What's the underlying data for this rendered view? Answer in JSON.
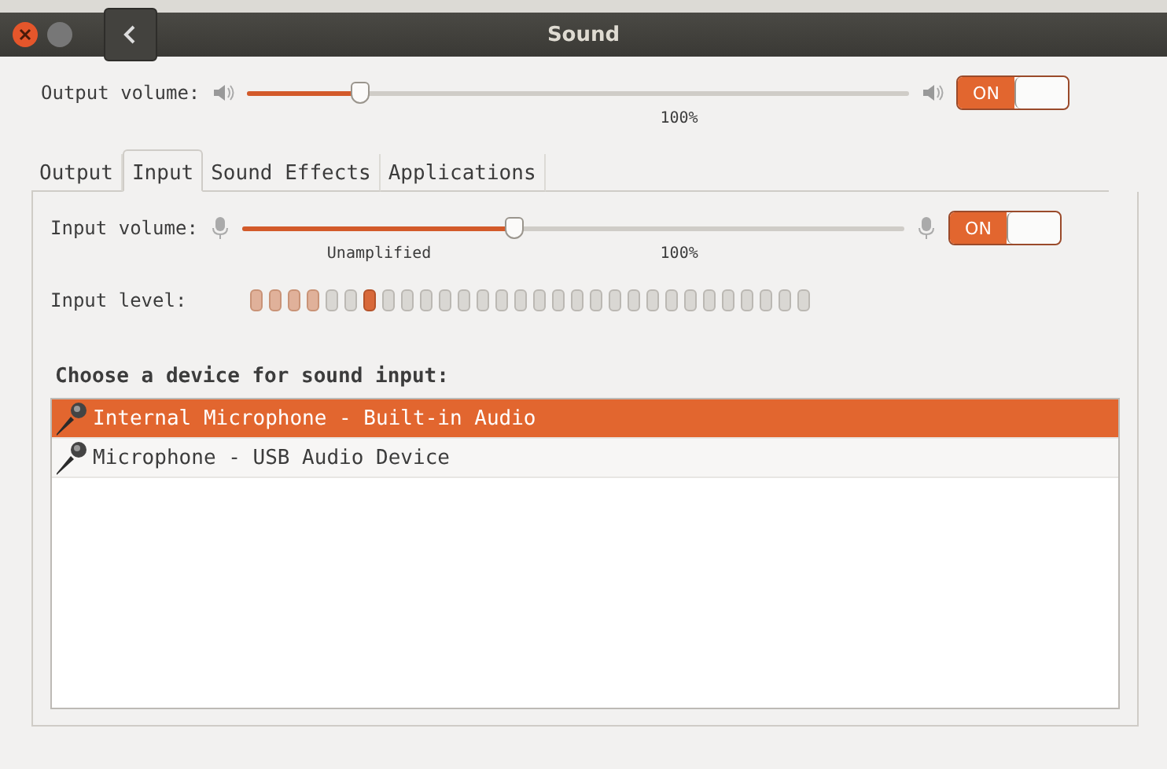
{
  "window": {
    "title": "Sound"
  },
  "output_volume": {
    "label": "Output volume:",
    "level": 0.17,
    "marks": [
      {
        "label": "100%"
      }
    ],
    "switch": {
      "label": "ON",
      "on": true
    }
  },
  "tabs": [
    {
      "label": "Output",
      "selected": false
    },
    {
      "label": "Input",
      "selected": true
    },
    {
      "label": "Sound Effects",
      "selected": false
    },
    {
      "label": "Applications",
      "selected": false
    }
  ],
  "input_volume": {
    "label": "Input volume:",
    "level": 0.41,
    "marks": [
      {
        "label": "Unamplified"
      },
      {
        "label": "100%"
      }
    ],
    "switch": {
      "label": "ON",
      "on": true
    }
  },
  "input_level": {
    "label": "Input level:",
    "segments": [
      {
        "kind": "lit"
      },
      {
        "kind": "lit"
      },
      {
        "kind": "lit"
      },
      {
        "kind": "lit"
      },
      {
        "kind": "off"
      },
      {
        "kind": "off"
      },
      {
        "kind": "peak"
      },
      {
        "kind": "off"
      },
      {
        "kind": "off"
      },
      {
        "kind": "off"
      },
      {
        "kind": "off"
      },
      {
        "kind": "off"
      },
      {
        "kind": "off"
      },
      {
        "kind": "off"
      },
      {
        "kind": "off"
      },
      {
        "kind": "off"
      },
      {
        "kind": "off"
      },
      {
        "kind": "off"
      },
      {
        "kind": "off"
      },
      {
        "kind": "off"
      },
      {
        "kind": "off"
      },
      {
        "kind": "off"
      },
      {
        "kind": "off"
      },
      {
        "kind": "off"
      },
      {
        "kind": "off"
      },
      {
        "kind": "off"
      },
      {
        "kind": "off"
      },
      {
        "kind": "off"
      },
      {
        "kind": "off"
      },
      {
        "kind": "off"
      }
    ]
  },
  "device_heading": "Choose a device for sound input:",
  "devices": [
    {
      "name": "Internal Microphone - Built-in Audio",
      "selected": true
    },
    {
      "name": "Microphone - USB Audio Device",
      "selected": false
    }
  ]
}
